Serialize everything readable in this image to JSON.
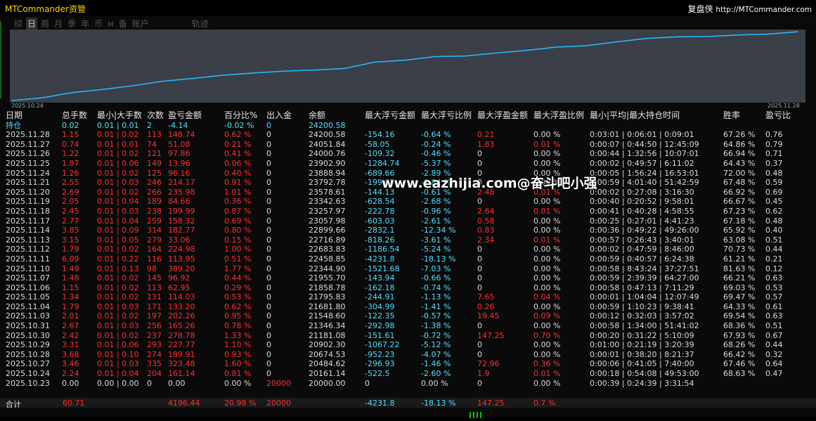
{
  "app": {
    "title": "MTCommander资管",
    "brand": "复盘侠",
    "url": "http://MTCommander.com"
  },
  "tabs": [
    {
      "label": "综",
      "active": false
    },
    {
      "label": "日",
      "active": true
    },
    {
      "label": "周",
      "active": false
    },
    {
      "label": "月",
      "active": false
    },
    {
      "label": "季",
      "active": false
    },
    {
      "label": "年",
      "active": false
    },
    {
      "label": "币",
      "active": false
    },
    {
      "label": "M",
      "active": false
    },
    {
      "label": "备",
      "active": false
    },
    {
      "label": "账户",
      "active": false
    },
    {
      "label": "轨迹",
      "active": false
    }
  ],
  "chart_data": {
    "type": "line",
    "title": "",
    "x_start_label": "2025.10.24",
    "x_end_label": "2025.11.28",
    "x": [
      "2025.10.23",
      "2025.10.24",
      "2025.10.27",
      "2025.10.28",
      "2025.10.29",
      "2025.10.30",
      "2025.10.31",
      "2025.11.03",
      "2025.11.04",
      "2025.11.05",
      "2025.11.06",
      "2025.11.07",
      "2025.11.10",
      "2025.11.11",
      "2025.11.12",
      "2025.11.13",
      "2025.11.14",
      "2025.11.17",
      "2025.11.18",
      "2025.11.19",
      "2025.11.20",
      "2025.11.21",
      "2025.11.24",
      "2025.11.25",
      "2025.11.26",
      "2025.11.27",
      "2025.11.28"
    ],
    "series": [
      {
        "name": "",
        "color": "#29b6f6",
        "values": [
          20000.0,
          20161.14,
          20484.62,
          20674.53,
          20902.3,
          21181.08,
          21346.34,
          21548.6,
          21681.8,
          21795.83,
          21858.78,
          21955.7,
          22344.9,
          22458.85,
          22683.83,
          22716.89,
          22899.66,
          23057.98,
          23257.97,
          23342.63,
          23578.61,
          23792.78,
          23888.94,
          23902.9,
          24000.76,
          24051.84,
          24200.58
        ]
      }
    ],
    "ylim": [
      20000,
      24250
    ],
    "grid": false
  },
  "watermark": "www.eazhijia.com@奋斗吧小强",
  "table": {
    "headers": [
      "日期",
      "总手数",
      "最小|大手数",
      "次数",
      "盈亏金额",
      "百分比%",
      "出入金",
      "余额",
      "最大浮亏金额",
      "最大浮亏比例",
      "最大浮盈金额",
      "最大浮盈比例",
      "最小|平均|最大持仓时间",
      "胜率",
      "盈亏比"
    ],
    "position_row": [
      "持仓",
      "0.02",
      "0.01 | 0.01",
      "2",
      "-4.14",
      "-0.02 %",
      "0",
      "24200.58",
      "",
      "",
      "",
      "",
      "",
      "",
      ""
    ],
    "rows": [
      [
        "2025.11.28",
        "1.15",
        "0.01 | 0.02",
        "113",
        "148.74",
        "0.62 %",
        "0",
        "24200.58",
        "-154.16",
        "-0.64 %",
        "0.21",
        "0.00 %",
        "0:03:01 | 0:06:01 | 0:09:01",
        "67.26 %",
        "0.76"
      ],
      [
        "2025.11.27",
        "0.74",
        "0.01 | 0.01",
        "74",
        "51.08",
        "0.21 %",
        "0",
        "24051.84",
        "-58.05",
        "-0.24 %",
        "1.83",
        "0.01 %",
        "0:00:07 | 0:44:50 | 12:45:09",
        "64.86 %",
        "0.79"
      ],
      [
        "2025.11.26",
        "1.22",
        "0.01 | 0.02",
        "121",
        "97.86",
        "0.41 %",
        "0",
        "24000.76",
        "-109.32",
        "-0.46 %",
        "0",
        "0.00 %",
        "0:00:44 | 1:32:56 | 10:07:01",
        "66.94 %",
        "0.71"
      ],
      [
        "2025.11.25",
        "1.87",
        "0.01 | 0.06",
        "149",
        "13.96",
        "0.06 %",
        "0",
        "23902.90",
        "-1284.74",
        "-5.37 %",
        "0",
        "0.00 %",
        "0:00:02 | 0:49:57 | 6:11:02",
        "64.43 %",
        "0.37"
      ],
      [
        "2025.11.24",
        "1.26",
        "0.01 | 0.02",
        "125",
        "96.16",
        "0.40 %",
        "0",
        "23888.94",
        "-689.66",
        "-2.89 %",
        "0",
        "0.00 %",
        "0:00:05 | 1:56:24 | 16:53:01",
        "72.00 %",
        "0.48"
      ],
      [
        "2025.11.21",
        "2.55",
        "0.01 | 0.03",
        "246",
        "214.17",
        "0.91 %",
        "0",
        "23792.78",
        "-199.65",
        "-0.84 %",
        "0",
        "0.00 %",
        "0:00:59 | 4:01:40 | 51:42:59",
        "67.48 %",
        "0.59"
      ],
      [
        "2025.11.20",
        "2.69",
        "0.01 | 0.02",
        "266",
        "235.98",
        "1.01 %",
        "0",
        "23578.61",
        "-144.13",
        "-0.61 %",
        "2.48",
        "0.01 %",
        "0:00:02 | 0:27:08 | 3:16:30",
        "66.92 %",
        "0.69"
      ],
      [
        "2025.11.19",
        "2.05",
        "0.01 | 0.04",
        "189",
        "84.66",
        "0.36 %",
        "0",
        "23342.63",
        "-628.54",
        "-2.68 %",
        "0",
        "0.00 %",
        "0:00:40 | 0:20:52 | 9:58:01",
        "66.67 %",
        "0.45"
      ],
      [
        "2025.11.18",
        "2.45",
        "0.01 | 0.03",
        "238",
        "199.99",
        "0.87 %",
        "0",
        "23257.97",
        "-222.78",
        "-0.96 %",
        "2.64",
        "0.01 %",
        "0:00:41 | 0:40:28 | 4:58:55",
        "67.23 %",
        "0.62"
      ],
      [
        "2025.11.17",
        "2.77",
        "0.01 | 0.04",
        "259",
        "158.32",
        "0.69 %",
        "0",
        "23057.98",
        "-603.03",
        "-2.61 %",
        "0.58",
        "0.00 %",
        "0:00:25 | 0:27:01 | 4:41:23",
        "67.18 %",
        "0.48"
      ],
      [
        "2025.11.14",
        "3.85",
        "0.01 | 0.09",
        "314",
        "182.77",
        "0.80 %",
        "0",
        "22899.66",
        "-2832.1",
        "-12.34 %",
        "0.83",
        "0.00 %",
        "0:00:36 | 0:49:22 | 49:26:00",
        "65.92 %",
        "0.40"
      ],
      [
        "2025.11.13",
        "3.15",
        "0.01 | 0.05",
        "279",
        "33.06",
        "0.15 %",
        "0",
        "22716.89",
        "-818.26",
        "-3.61 %",
        "2.34",
        "0.01 %",
        "0:00:57 | 0:26:43 | 3:40:01",
        "63.08 %",
        "0.51"
      ],
      [
        "2025.11.12",
        "1.79",
        "0.01 | 0.02",
        "164",
        "224.98",
        "1.00 %",
        "0",
        "22683.83",
        "-1186.54",
        "-5.24 %",
        "0",
        "0.00 %",
        "0:00:02 | 0:47:59 | 8:46:00",
        "70.73 %",
        "0.44"
      ],
      [
        "2025.11.11",
        "6.09",
        "0.01 | 0.22",
        "116",
        "113.95",
        "0.51 %",
        "0",
        "22458.85",
        "-4231.8",
        "-18.13 %",
        "0",
        "0.00 %",
        "0:00:59 | 0:40:57 | 6:24:38",
        "61.21 %",
        "0.21"
      ],
      [
        "2025.11.10",
        "1.49",
        "0.01 | 0.13",
        "98",
        "389.20",
        "1.77 %",
        "0",
        "22344.90",
        "-1521.68",
        "-7.03 %",
        "0",
        "0.00 %",
        "0:00:58 | 8:43:24 | 37:27:51",
        "81.63 %",
        "0.12"
      ],
      [
        "2025.11.07",
        "1.48",
        "0.01 | 0.02",
        "145",
        "96.92",
        "0.44 %",
        "0",
        "21955.70",
        "-143.94",
        "-0.66 %",
        "0",
        "0.00 %",
        "0:00:59 | 2:39:39 | 64:27:00",
        "66.21 %",
        "0.63"
      ],
      [
        "2025.11.06",
        "1.15",
        "0.01 | 0.02",
        "113",
        "62.95",
        "0.29 %",
        "0",
        "21858.78",
        "-162.18",
        "-0.74 %",
        "0",
        "0.00 %",
        "0:00:58 | 0:47:13 | 7:11:29",
        "69.03 %",
        "0.53"
      ],
      [
        "2025.11.05",
        "1.34",
        "0.01 | 0.02",
        "131",
        "114.03",
        "0.53 %",
        "0",
        "21795.83",
        "-244.91",
        "-1.13 %",
        "7.65",
        "0.04 %",
        "0:00:01 | 1:04:04 | 12:07:49",
        "69.47 %",
        "0.57"
      ],
      [
        "2025.11.04",
        "1.79",
        "0.01 | 0.03",
        "171",
        "133.20",
        "0.62 %",
        "0",
        "21681.80",
        "-304.99",
        "-1.41 %",
        "0.26",
        "0.00 %",
        "0:00:59 | 1:10:23 | 9:38:41",
        "64.33 %",
        "0.61"
      ],
      [
        "2025.11.03",
        "2.01",
        "0.01 | 0.02",
        "197",
        "202.26",
        "0.95 %",
        "0",
        "21548.60",
        "-122.35",
        "-0.57 %",
        "19.45",
        "0.09 %",
        "0:00:12 | 0:32:03 | 3:57:02",
        "69.54 %",
        "0.63"
      ],
      [
        "2025.10.31",
        "2.67",
        "0.01 | 0.03",
        "256",
        "165.26",
        "0.78 %",
        "0",
        "21346.34",
        "-292.98",
        "-1.38 %",
        "0",
        "0.00 %",
        "0:00:58 | 1:34:00 | 51:41:02",
        "68.36 %",
        "0.51"
      ],
      [
        "2025.10.30",
        "2.42",
        "0.01 | 0.02",
        "237",
        "278.78",
        "1.33 %",
        "0",
        "21181.08",
        "-151.61",
        "-0.72 %",
        "147.25",
        "0.70 %",
        "0:00:20 | 0:31:22 | 5:10:09",
        "67.93 %",
        "0.67"
      ],
      [
        "2025.10.29",
        "3.31",
        "0.01 | 0.06",
        "293",
        "227.77",
        "1.10 %",
        "0",
        "20902.30",
        "-1067.22",
        "-5.12 %",
        "0",
        "0.00 %",
        "0:01:00 | 0:21:19 | 3:20:39",
        "68.26 %",
        "0.44"
      ],
      [
        "2025.10.28",
        "3.68",
        "0.01 | 0.10",
        "274",
        "189.91",
        "0.93 %",
        "0",
        "20674.53",
        "-952.23",
        "-4.07 %",
        "0",
        "0.00 %",
        "0:00:01 | 0:38:20 | 8:21:37",
        "66.42 %",
        "0.32"
      ],
      [
        "2025.10.27",
        "3.46",
        "0.01 | 0.03",
        "335",
        "323.48",
        "1.60 %",
        "0",
        "20484.62",
        "-296.93",
        "-1.46 %",
        "72.96",
        "0.36 %",
        "0:00:06 | 0:41:05 | 7:40:00",
        "67.46 %",
        "0.64"
      ],
      [
        "2025.10.24",
        "2.24",
        "0.01 | 0.04",
        "204",
        "161.14",
        "0.81 %",
        "0",
        "20161.14",
        "-522.5",
        "-2.60 %",
        "1.9",
        "0.01 %",
        "0:00:18 | 0:54:08 | 49:53:00",
        "68.63 %",
        "0.47"
      ],
      [
        "2025.10.23",
        "0.00",
        "0.00 | 0.00",
        "0",
        "0.00",
        "0.00 %",
        "20000",
        "20000.00",
        "0",
        "0.00 %",
        "0",
        "0.00 %",
        "0:00:39 | 0:24:39 | 3:31:54",
        "",
        ""
      ]
    ],
    "totals": {
      "label": "合计",
      "total_lots": "60.71",
      "pl": "4196.44",
      "pct": "20.98 %",
      "inout": "20000",
      "max_loss": "-4231.8",
      "max_loss_pct": "-18.13 %",
      "max_profit": "147.25",
      "max_profit_pct": "0.7 %"
    }
  }
}
